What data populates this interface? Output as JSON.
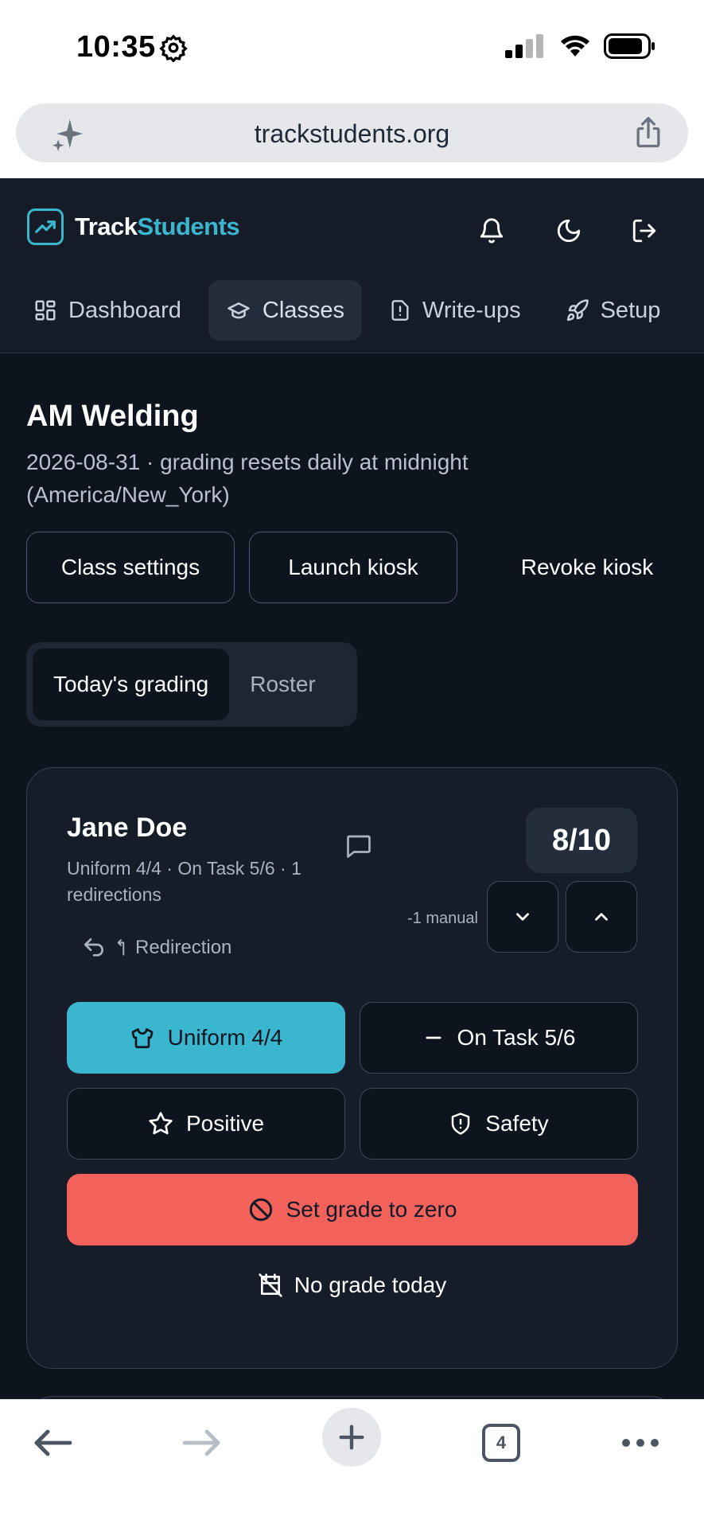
{
  "status_bar": {
    "time": "10:35"
  },
  "browser": {
    "url": "trackstudents.org",
    "tab_count": "4"
  },
  "app": {
    "brand_left": "Track",
    "brand_right": "Students",
    "accent_color": "#3bb6cf"
  },
  "nav": {
    "items": [
      {
        "label": "Dashboard",
        "icon": "dashboard-icon",
        "active": false
      },
      {
        "label": "Classes",
        "icon": "graduation-cap-icon",
        "active": true
      },
      {
        "label": "Write-ups",
        "icon": "alert-file-icon",
        "active": false
      },
      {
        "label": "Setup",
        "icon": "rocket-icon",
        "active": false
      }
    ]
  },
  "page": {
    "title": "AM Welding",
    "subtitle": "2026-08-31 · grading resets daily at midnight (America/New_York)",
    "buttons": {
      "class_settings": "Class settings",
      "launch_kiosk": "Launch kiosk",
      "revoke_kiosk": "Revoke kiosk"
    },
    "tabs": [
      {
        "label": "Today's grading",
        "active": true
      },
      {
        "label": "Roster",
        "active": false
      }
    ]
  },
  "student": {
    "name": "Jane Doe",
    "meta": "Uniform 4/4 · On Task 5/6 · 1 redirections",
    "score": "8/10",
    "manual_adjust": "-1 manual",
    "redirection_label": "Redirection",
    "actions": {
      "uniform": "Uniform 4/4",
      "on_task": "On Task 5/6",
      "positive": "Positive",
      "safety": "Safety",
      "zero": "Set grade to zero",
      "no_grade": "No grade today"
    },
    "colors": {
      "uniform_active": "#3bb6cf",
      "danger": "#f2625b"
    }
  }
}
